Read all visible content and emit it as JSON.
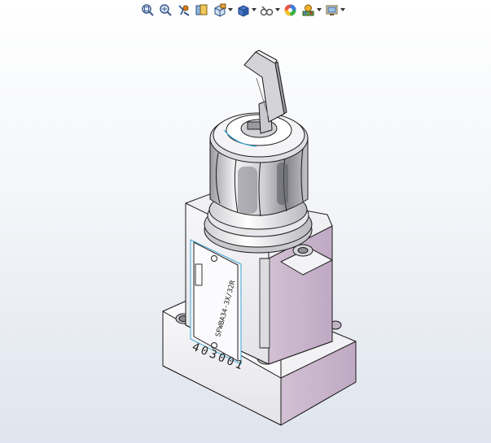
{
  "toolbar": {
    "items": [
      {
        "name": "zoom-to-fit",
        "icon": "zoom-fit-icon"
      },
      {
        "name": "zoom-to-area",
        "icon": "zoom-area-icon"
      },
      {
        "name": "previous-view",
        "icon": "previous-view-icon"
      },
      {
        "name": "section-view",
        "icon": "section-view-icon"
      },
      {
        "name": "view-orientation",
        "icon": "view-orientation-icon",
        "dropdown": true
      },
      {
        "name": "display-style",
        "icon": "display-style-icon",
        "dropdown": true
      },
      {
        "name": "hide-show-items",
        "icon": "hide-show-icon",
        "dropdown": true
      },
      {
        "name": "edit-appearance",
        "icon": "appearance-icon"
      },
      {
        "name": "apply-scene",
        "icon": "scene-icon",
        "dropdown": true
      },
      {
        "name": "view-settings",
        "icon": "view-settings-icon",
        "dropdown": true
      }
    ]
  },
  "model": {
    "side_label": "SFWBA34-3X/32R",
    "front_number": "403001"
  },
  "colors": {
    "body_light": "#f4f4f6",
    "body_mid": "#d9d9de",
    "body_side": "#c7b7c9",
    "edge": "#1a1a1a",
    "accent_blue": "#3aa7d8"
  }
}
